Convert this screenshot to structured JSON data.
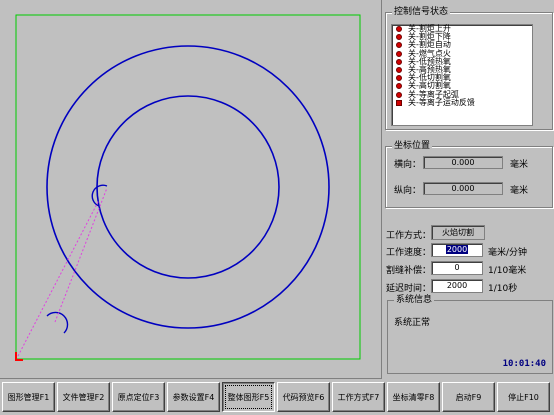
{
  "signals": {
    "title": "控制信号状态",
    "items": [
      {
        "state": "关",
        "label": "割炬上升",
        "marker": "dot"
      },
      {
        "state": "关",
        "label": "割炬下降",
        "marker": "dot"
      },
      {
        "state": "关",
        "label": "割炬自动",
        "marker": "dot"
      },
      {
        "state": "关",
        "label": "燃气点火",
        "marker": "dot"
      },
      {
        "state": "关",
        "label": "低预热氧",
        "marker": "dot"
      },
      {
        "state": "关",
        "label": "高预热氧",
        "marker": "dot"
      },
      {
        "state": "关",
        "label": "低切割氧",
        "marker": "dot"
      },
      {
        "state": "关",
        "label": "高切割氧",
        "marker": "dot"
      },
      {
        "state": "关",
        "label": "等离子起弧",
        "marker": "dot"
      },
      {
        "state": "关",
        "label": "等离子运动反馈",
        "marker": "square"
      }
    ]
  },
  "coords": {
    "title": "坐标位置",
    "x_label": "横向：",
    "x_value": "0.000",
    "y_label": "纵向：",
    "y_value": "0.000",
    "unit": "毫米"
  },
  "work": {
    "mode_label": "工作方式：",
    "mode_value": "火焰切割",
    "speed_label": "工作速度：",
    "speed_value": "2000",
    "speed_unit": "毫米/分钟",
    "kerf_label": "割缝补偿：",
    "kerf_value": "0",
    "kerf_unit": "1/10毫米",
    "delay_label": "延迟时间：",
    "delay_value": "2000",
    "delay_unit": "1/10秒"
  },
  "sysinfo": {
    "title": "系统信息",
    "message": "系统正常",
    "clock": "10:01:40"
  },
  "fkeys": [
    {
      "label": "图形管理F1",
      "active": false
    },
    {
      "label": "文件管理F2",
      "active": false
    },
    {
      "label": "原点定位F3",
      "active": false
    },
    {
      "label": "参数设置F4",
      "active": false
    },
    {
      "label": "整体图形F5",
      "active": true
    },
    {
      "label": "代码预览F6",
      "active": false
    },
    {
      "label": "工作方式F7",
      "active": false
    },
    {
      "label": "坐标清零F8",
      "active": false
    },
    {
      "label": "启动F9",
      "active": false
    },
    {
      "label": "停止F10",
      "active": false
    }
  ],
  "colors": {
    "frame": "#00cc00",
    "shape": "#0000c0",
    "path": "#e040e0",
    "origin": "#ff0000"
  }
}
